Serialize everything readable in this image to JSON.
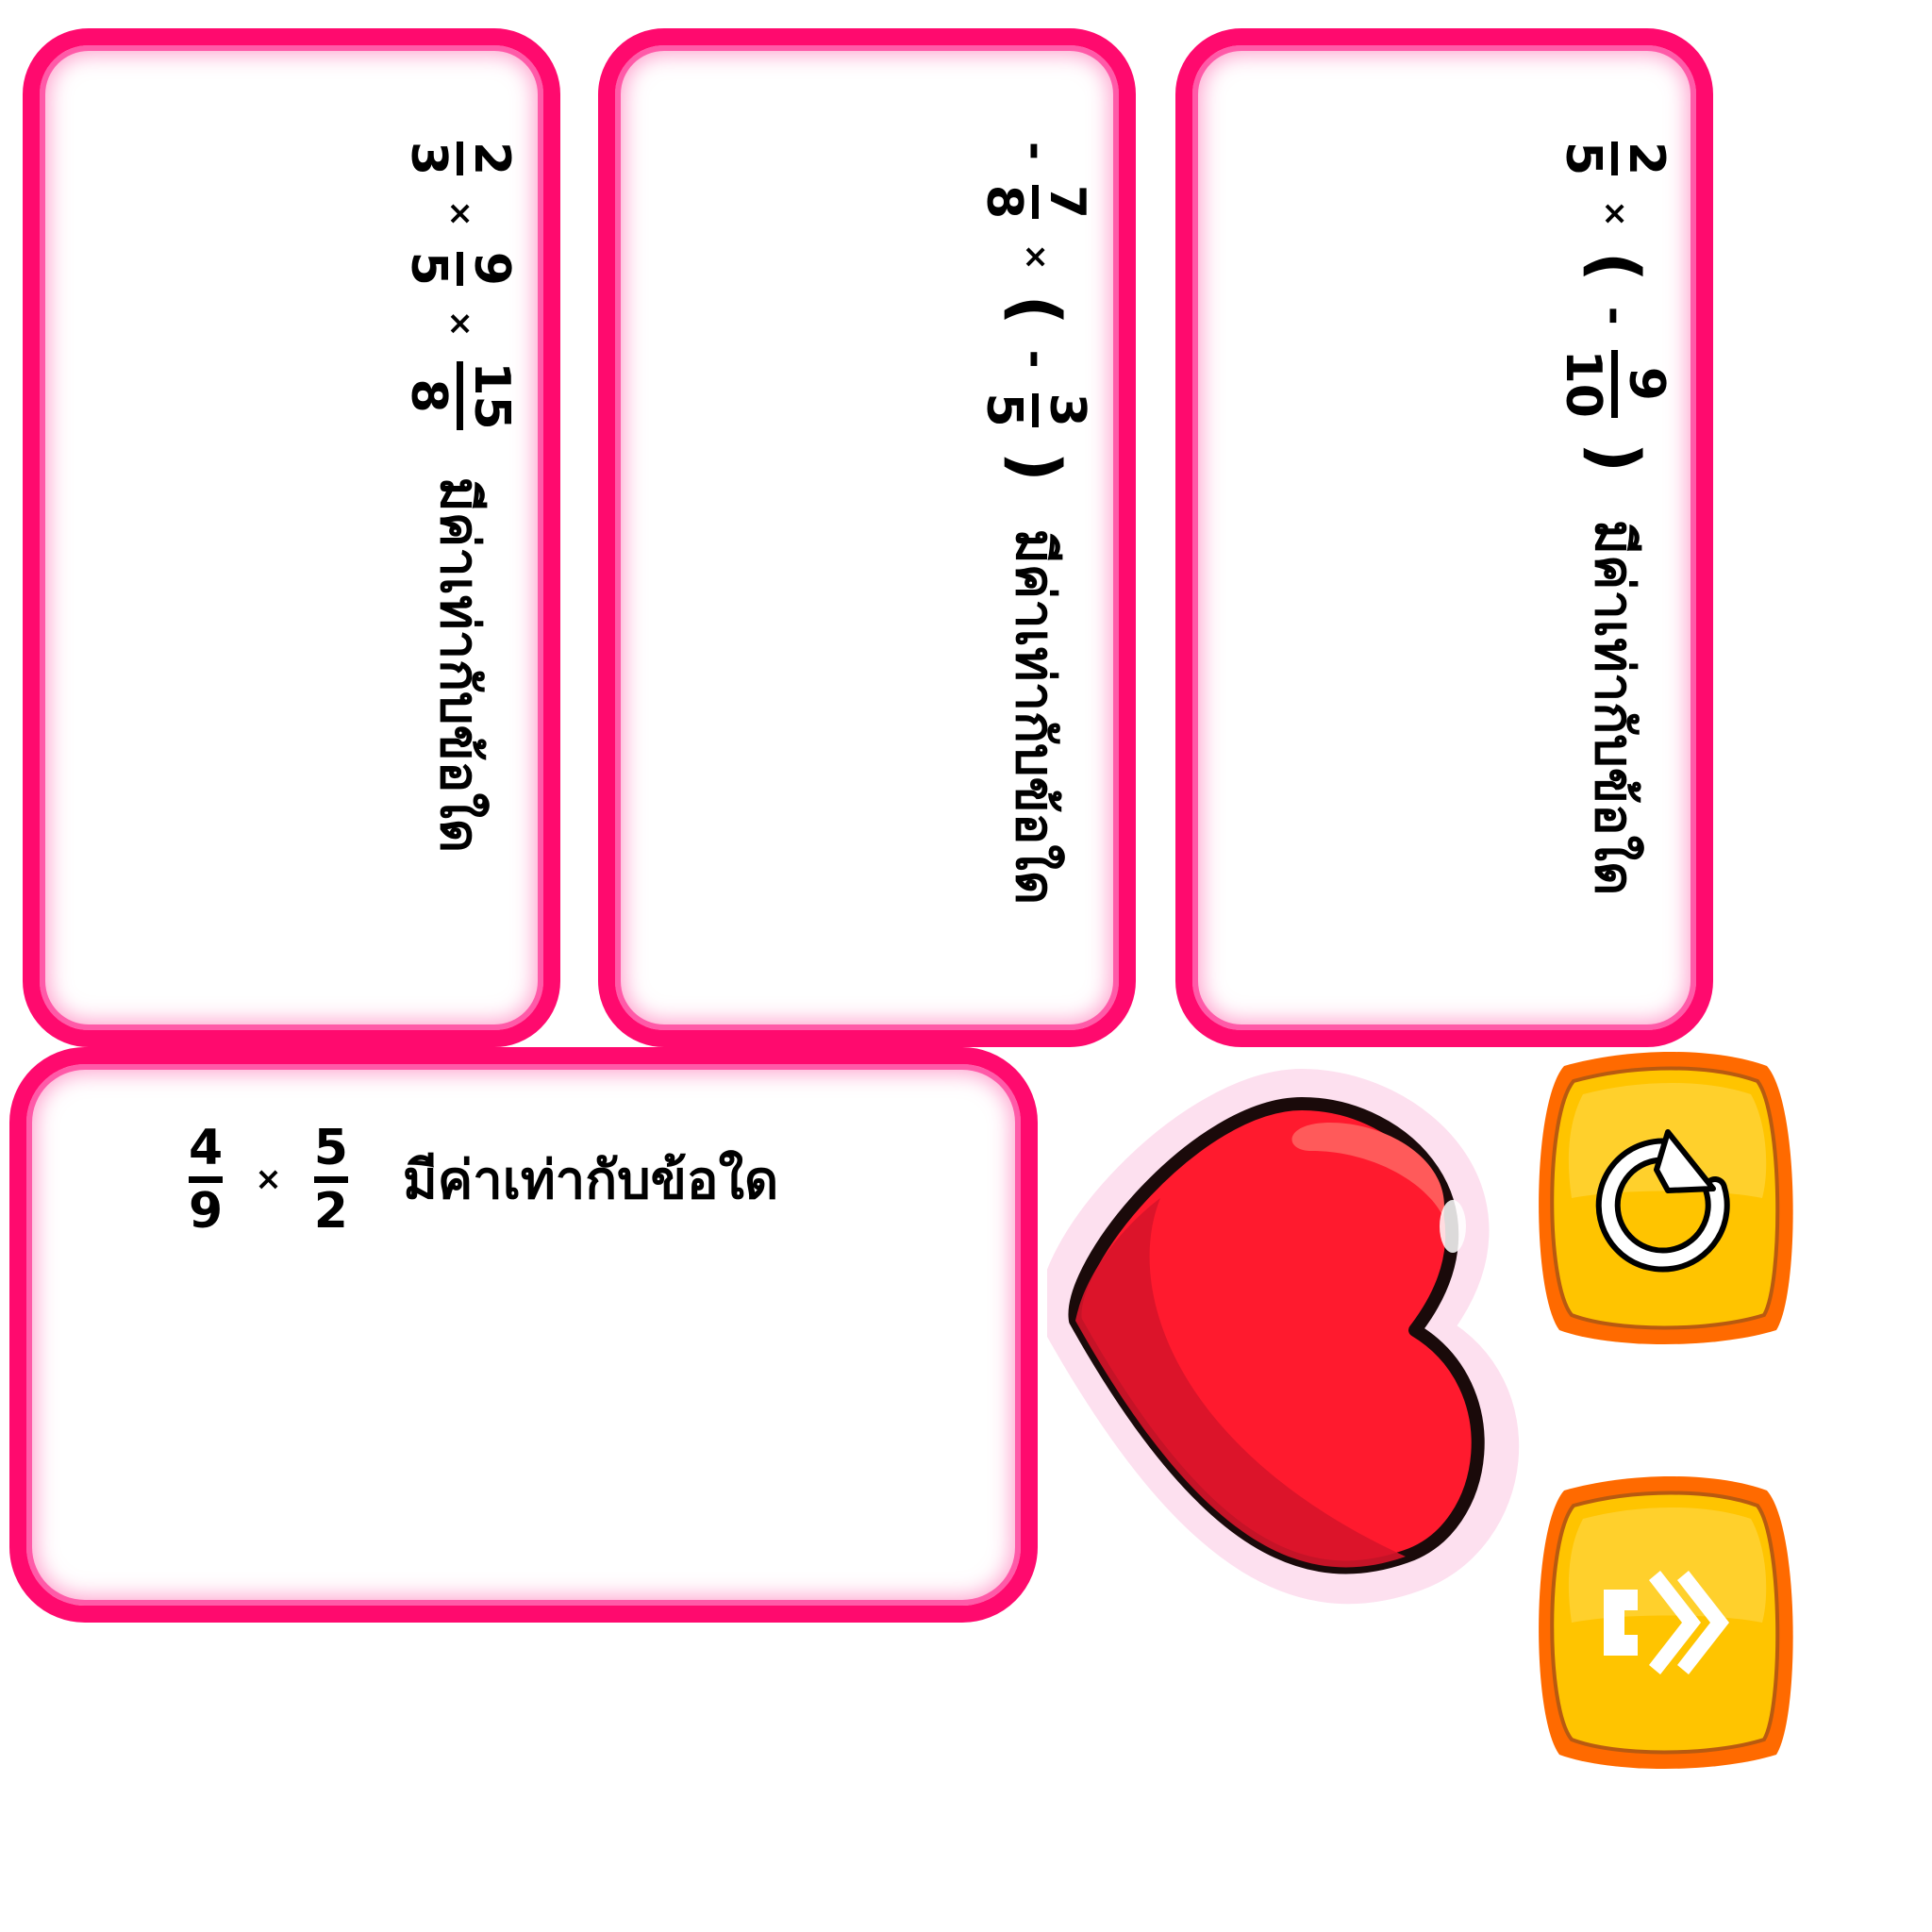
{
  "question_text": "มีค่าเท่ากับข้อใด",
  "cards": [
    {
      "id": 1,
      "terms": [
        {
          "num": "2",
          "den": "3"
        },
        {
          "op": "×"
        },
        {
          "num": "9",
          "den": "5"
        },
        {
          "op": "×"
        },
        {
          "num": "15",
          "den": "8"
        }
      ]
    },
    {
      "id": 2,
      "terms": [
        {
          "num": "7",
          "den": "8",
          "sign": "-"
        },
        {
          "op": "×"
        },
        {
          "num": "3",
          "den": "5",
          "sign": "-",
          "paren": true
        }
      ]
    },
    {
      "id": 3,
      "terms": [
        {
          "num": "2",
          "den": "5"
        },
        {
          "op": "×"
        },
        {
          "num": "9",
          "den": "10",
          "sign": "-",
          "paren": true
        }
      ]
    },
    {
      "id": 4,
      "terms": [
        {
          "num": "4",
          "den": "9"
        },
        {
          "op": "×"
        },
        {
          "num": "5",
          "den": "2"
        }
      ]
    }
  ],
  "colors": {
    "card_border": "#ff0a6e",
    "card_glow": "#ff5aa8",
    "heart": "#ff1a2e",
    "button_outer": "#ff6a00",
    "button_inner": "#ffc400"
  },
  "icons": {
    "heart": "heart-icon",
    "restart": "restart-icon",
    "next": "next-icon"
  }
}
